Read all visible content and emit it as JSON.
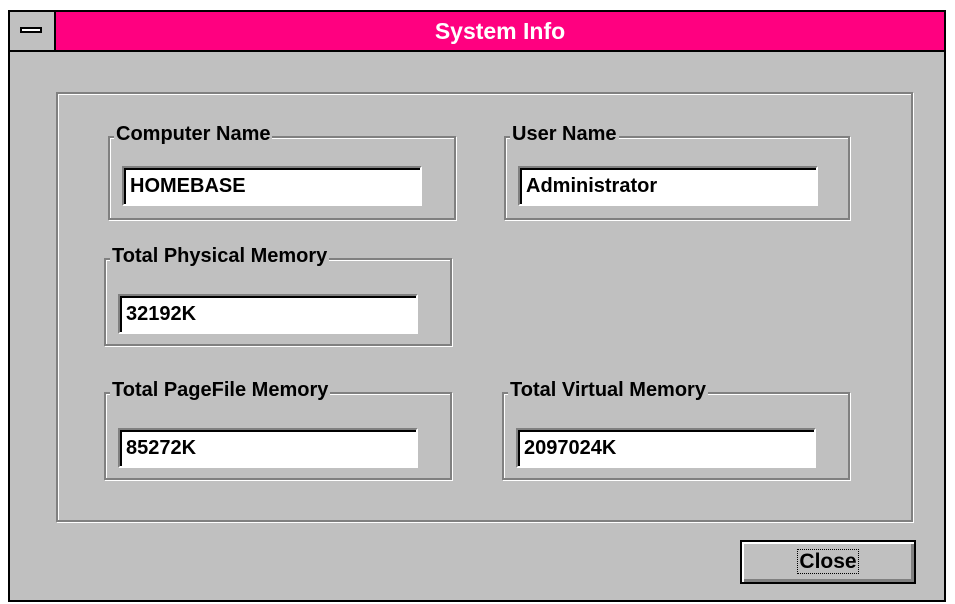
{
  "window": {
    "title": "System Info"
  },
  "fields": {
    "computer_name": {
      "label": "Computer Name",
      "value": "HOMEBASE"
    },
    "user_name": {
      "label": "User Name",
      "value": "Administrator"
    },
    "total_physical_memory": {
      "label": "Total Physical Memory",
      "value": "32192K"
    },
    "total_pagefile_memory": {
      "label": "Total PageFile Memory",
      "value": "85272K"
    },
    "total_virtual_memory": {
      "label": "Total Virtual Memory",
      "value": "2097024K"
    }
  },
  "buttons": {
    "close_label": "Close"
  },
  "colors": {
    "titlebar": "#ff0080",
    "face": "#c0c0c0",
    "shadow": "#808080"
  },
  "icons": {
    "system_menu": "system-menu-icon"
  }
}
